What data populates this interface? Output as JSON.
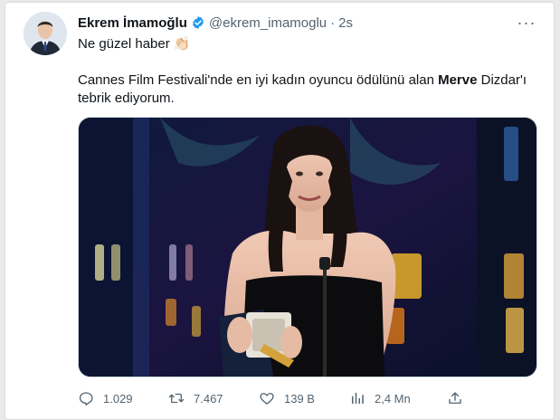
{
  "tweet": {
    "author_name": "Ekrem İmamoğlu",
    "handle": "@ekrem_imamoglu",
    "separator": "·",
    "time": "2s",
    "more": "···",
    "line1": "Ne güzel haber",
    "emoji": "👏🏻",
    "line2_before": "Cannes Film Festivali'nde en iyi kadın oyuncu ödülünü alan ",
    "line2_bold": "Merve",
    "line2_after": " Dizdar'ı tebrik ediyorum."
  },
  "actions": {
    "replies": "1.029",
    "retweets": "7.467",
    "likes": "139 B",
    "views": "2,4 Mn"
  },
  "colors": {
    "verified": "#1d9bf0",
    "muted": "#536471",
    "text": "#0f1419"
  },
  "icons": [
    "verified-badge-icon",
    "more-icon",
    "reply-icon",
    "retweet-icon",
    "like-icon",
    "views-icon",
    "share-icon"
  ]
}
